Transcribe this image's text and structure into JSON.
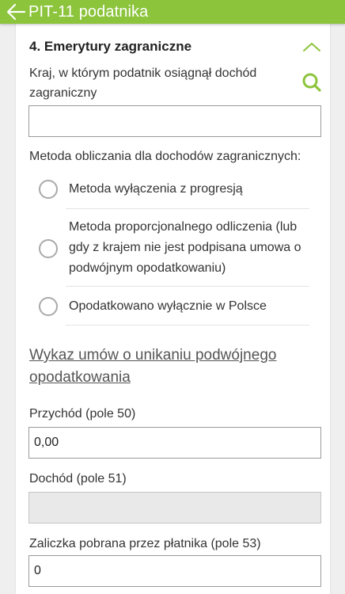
{
  "appbar": {
    "title": "PIT-11 podatnika",
    "back_icon": "arrow-left-icon",
    "color": "#8cc43c"
  },
  "section": {
    "title": "4. Emerytury zagraniczne",
    "collapse_icon": "chevron-up-icon",
    "accent": "#8cc43c"
  },
  "country": {
    "label_line1": "Kraj, w którym podatnik osiągnął dochód",
    "label_line2": "zagraniczny",
    "search_icon": "search-icon",
    "value": ""
  },
  "method": {
    "label": "Metoda obliczania dla dochodów zagranicznych:",
    "options": [
      {
        "lines": [
          "Metoda wyłączenia z progresją"
        ],
        "selected": false
      },
      {
        "lines": [
          "Metoda proporcjonalnego odliczenia (lub",
          "gdy z krajem nie jest podpisana umowa o",
          "podwójnym opodatkowaniu)"
        ],
        "selected": false
      },
      {
        "lines": [
          "Opodatkowano wyłącznie w Polsce"
        ],
        "selected": false
      }
    ]
  },
  "link": {
    "line1": "Wykaz umów o unikaniu podwójnego",
    "line2": "opodatkowania"
  },
  "fields": {
    "przychod": {
      "label": "Przychód (pole 50)",
      "value": "0,00"
    },
    "dochod": {
      "label": "Dochód (pole 51)",
      "value": ""
    },
    "zaliczka": {
      "label": "Zaliczka pobrana przez płatnika (pole 53)",
      "value": "0"
    }
  }
}
